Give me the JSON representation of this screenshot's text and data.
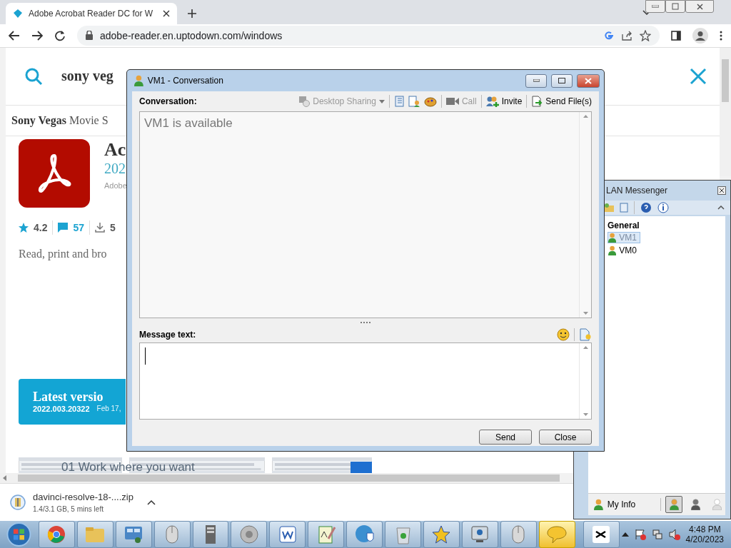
{
  "browser": {
    "tab": {
      "title": "Adobe Acrobat Reader DC for W"
    },
    "address": "adobe-reader.en.uptodown.com/windows"
  },
  "page": {
    "search": {
      "value": "sony veg"
    },
    "suggestion": {
      "term": "Sony Vegas",
      "rest": "Movie S"
    },
    "app": {
      "name": "Ac",
      "version": "202",
      "publisher": "Adobe",
      "rating": "4.2",
      "comments": "57",
      "downloads": "5",
      "description": "Read, print and bro"
    },
    "latest": {
      "title": "Latest versio",
      "version": "2022.003.20322",
      "date": "Feb 17,"
    },
    "preview": {
      "heading": "01 Work where you want"
    }
  },
  "download": {
    "file": "davinci-resolve-18-....zip",
    "progress": "1.4/3.1 GB, 5 mins left"
  },
  "conversation": {
    "title": "VM1 - Conversation",
    "label": "Conversation:",
    "toolbar": {
      "desktop_sharing": {
        "label": "Desktop Sharing",
        "disabled": true
      },
      "call": {
        "label": "Call",
        "disabled": true
      },
      "invite": {
        "label": "Invite",
        "disabled": false
      },
      "send_files": {
        "label": "Send File(s)",
        "disabled": false
      }
    },
    "history": "VM1 is available",
    "message_label": "Message text:",
    "buttons": [
      "Send",
      "Close"
    ]
  },
  "messenger": {
    "title": "LAN Messenger",
    "group": "General",
    "contacts": [
      {
        "name": "VM1",
        "selected": true
      },
      {
        "name": "VM0",
        "selected": false
      }
    ],
    "my_info": "My Info",
    "statuses": [
      {
        "kind": "online",
        "selected": true
      },
      {
        "kind": "busy",
        "selected": false
      },
      {
        "kind": "offline",
        "selected": false
      }
    ]
  },
  "taskbar": {
    "apps": [
      {
        "kind": "chrome",
        "selected": false
      },
      {
        "kind": "folder",
        "selected": false
      },
      {
        "kind": "panel",
        "selected": false
      },
      {
        "kind": "mouse",
        "selected": false
      },
      {
        "kind": "server",
        "selected": false
      },
      {
        "kind": "speaker",
        "selected": false
      },
      {
        "kind": "writer",
        "selected": false
      },
      {
        "kind": "notepad",
        "selected": false
      },
      {
        "kind": "shield",
        "selected": false
      },
      {
        "kind": "bin",
        "selected": false
      },
      {
        "kind": "star",
        "selected": false
      },
      {
        "kind": "display",
        "selected": false
      },
      {
        "kind": "mouse",
        "selected": false
      },
      {
        "kind": "chat",
        "selected": true
      },
      {
        "kind": "capcut",
        "selected": false
      }
    ],
    "time": "4:48 PM",
    "date": "4/20/2023"
  }
}
